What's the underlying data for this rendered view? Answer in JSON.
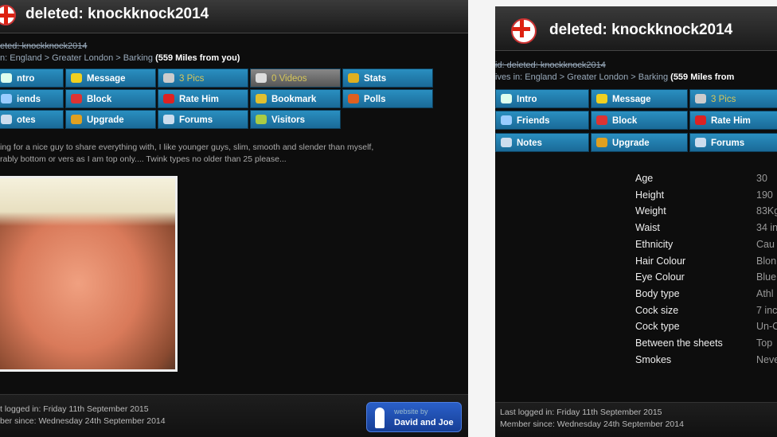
{
  "left": {
    "title": "deleted: knockknock2014",
    "id_line": "eted: knockknock2014",
    "location_line": "n: England > Greater London > Barking",
    "distance": "(559 Miles from you)",
    "buttons": [
      {
        "label": "ntro",
        "icon": "intro-icon",
        "color": "#dfe"
      },
      {
        "label": "Message",
        "icon": "envelope-icon",
        "color": "#f0d020"
      },
      {
        "label": "3 Pics",
        "icon": "camera-icon",
        "color": "#ccc"
      },
      {
        "label": "0 Videos",
        "icon": "play-icon",
        "color": "#ddd"
      },
      {
        "label": "Stats",
        "icon": "bar-chart-icon",
        "color": "#e0b020"
      },
      {
        "label": "iends",
        "icon": "friends-icon",
        "color": "#9cf"
      },
      {
        "label": "Block",
        "icon": "block-icon",
        "color": "#d33"
      },
      {
        "label": "Rate Him",
        "icon": "heart-icon",
        "color": "#d22"
      },
      {
        "label": "Bookmark",
        "icon": "star-icon",
        "color": "#e0c030"
      },
      {
        "label": "Polls",
        "icon": "pie-chart-icon",
        "color": "#e06020"
      },
      {
        "label": "otes",
        "icon": "notes-icon",
        "color": "#cde"
      },
      {
        "label": "Upgrade",
        "icon": "upgrade-icon",
        "color": "#e0a020"
      },
      {
        "label": "Forums",
        "icon": "forums-icon",
        "color": "#cde"
      },
      {
        "label": "Visitors",
        "icon": "visitors-icon",
        "color": "#ac4"
      }
    ],
    "description": [
      "ing for a nice guy to share everything with,  I like younger guys, slim, smooth and slender than myself,",
      "rably bottom or vers as I am top only.... Twink types no older than 25 please..."
    ],
    "last_logged": "t logged in: Friday 11th September 2015",
    "member_since": "ber since: Wednesday 24th September 2014",
    "badge_small": "website by",
    "badge_big": "David and Joe"
  },
  "right": {
    "title": "deleted: knockknock2014",
    "id_line": "id: deleted: knockknock2014",
    "location_line": "ives in: England > Greater London > Barking",
    "distance": "(559 Miles from",
    "buttons": [
      {
        "label": "Intro",
        "icon": "intro-icon",
        "color": "#dfe"
      },
      {
        "label": "Message",
        "icon": "envelope-icon",
        "color": "#f0d020"
      },
      {
        "label": "3 Pics",
        "icon": "camera-icon",
        "color": "#ccc"
      },
      {
        "label": "Friends",
        "icon": "friends-icon",
        "color": "#9cf"
      },
      {
        "label": "Block",
        "icon": "block-icon",
        "color": "#d33"
      },
      {
        "label": "Rate Him",
        "icon": "heart-icon",
        "color": "#d22"
      },
      {
        "label": "Notes",
        "icon": "notes-icon",
        "color": "#cde"
      },
      {
        "label": "Upgrade",
        "icon": "upgrade-icon",
        "color": "#e0a020"
      },
      {
        "label": "Forums",
        "icon": "forums-icon",
        "color": "#cde"
      }
    ],
    "stats": [
      {
        "label": "Age",
        "value": "30"
      },
      {
        "label": "Height",
        "value": "190"
      },
      {
        "label": "Weight",
        "value": "83Kg"
      },
      {
        "label": "Waist",
        "value": "34 in"
      },
      {
        "label": "Ethnicity",
        "value": "Cau"
      },
      {
        "label": "Hair Colour",
        "value": "Blon"
      },
      {
        "label": "Eye Colour",
        "value": "Blue"
      },
      {
        "label": "Body type",
        "value": "Athl"
      },
      {
        "label": "Cock size",
        "value": "7 inc"
      },
      {
        "label": "Cock type",
        "value": "Un-C"
      },
      {
        "label": "Between the sheets",
        "value": "Top"
      },
      {
        "label": "Smokes",
        "value": "Neve"
      }
    ],
    "last_logged": "Last logged in: Friday 11th September 2015",
    "member_since": "Member since: Wednesday 24th September 2014"
  }
}
